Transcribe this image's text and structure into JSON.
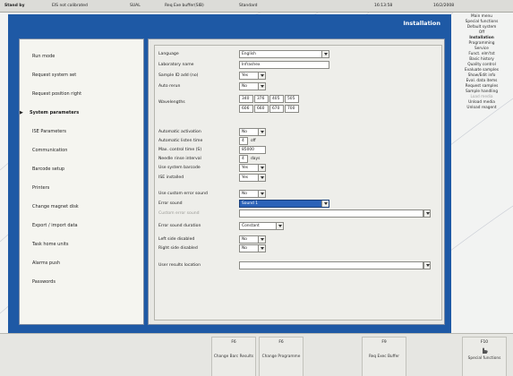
{
  "status_bar": {
    "state": "Stand by",
    "items": [
      "EIS not calibrated",
      "SUAL",
      "Req Exe buffer(SIB)",
      "Standard"
    ],
    "time": "16:13:58",
    "date": "16/2/2008"
  },
  "panel": {
    "title": "Installation"
  },
  "nav": {
    "items": [
      {
        "label": "Run mode",
        "active": false
      },
      {
        "label": "Request system set",
        "active": false
      },
      {
        "label": "Request position right",
        "active": false
      },
      {
        "label": "System parameters",
        "active": true
      },
      {
        "label": "ISE Parameters",
        "active": false
      },
      {
        "label": "Communication",
        "active": false
      },
      {
        "label": "Barcode setup",
        "active": false
      },
      {
        "label": "Printers",
        "active": false
      },
      {
        "label": "Change magnet disk",
        "active": false
      },
      {
        "label": "Export / import data",
        "active": false
      },
      {
        "label": "Task home units",
        "active": false
      },
      {
        "label": "Alarms push",
        "active": false
      },
      {
        "label": "Passwords",
        "active": false
      }
    ]
  },
  "form": {
    "language": {
      "label": "Language",
      "value": "English"
    },
    "lab_name": {
      "label": "Laboratory name",
      "value": "Infrashex"
    },
    "sample_id_bar": {
      "label": "Sample ID add (no)",
      "value": "Yes"
    },
    "auto_rerun": {
      "label": "Auto rerun",
      "value": "No"
    },
    "wavelengths": {
      "label": "Wavelengths",
      "values": [
        "340",
        "376",
        "405",
        "505",
        "606",
        "660",
        "670",
        "700"
      ]
    },
    "automatic_activation": {
      "label": "Automatic activation",
      "value": "No"
    },
    "auto_dilution_time": {
      "label": "Automatic listen time",
      "value": "4",
      "unit": "off"
    },
    "max_control_time": {
      "label": "Max. control time (S)",
      "value": "85000"
    },
    "needle_rinse_interval": {
      "label": "Needle rinse interval",
      "value": "4",
      "unit": "days"
    },
    "use_system_barcode": {
      "label": "Use system barcode",
      "value": "Yes"
    },
    "ise_installed": {
      "label": "ISE installed",
      "value": "Yes"
    },
    "use_custom_error_sound": {
      "label": "Use custom error sound",
      "value": "No"
    },
    "error_sound": {
      "label": "Error sound",
      "value": "Sound 1"
    },
    "custom_error_sound": {
      "label": "Custom error sound",
      "value": ""
    },
    "error_sound_duration": {
      "label": "Error sound duration",
      "value": "Constant"
    },
    "left_side_disabled": {
      "label": "Left side disabled",
      "value": "No"
    },
    "right_side_disabled": {
      "label": "Right side disabled",
      "value": "No"
    },
    "user_results_location": {
      "label": "User results location",
      "value": ""
    }
  },
  "menu_tree": {
    "items": [
      {
        "label": "Main menu",
        "dim": false
      },
      {
        "label": "Special functions",
        "dim": false
      },
      {
        "label": "Default system",
        "dim": false
      },
      {
        "label": "Off",
        "dim": false
      },
      {
        "label": "Installation",
        "dim": false
      },
      {
        "label": "Programming",
        "dim": false
      },
      {
        "label": "Service",
        "dim": false
      },
      {
        "label": "Funct. elm'tst",
        "dim": false
      },
      {
        "label": "Basic history",
        "dim": false
      },
      {
        "label": "Quality control",
        "dim": false
      },
      {
        "label": "Evaluate samples",
        "dim": false
      },
      {
        "label": "Show/Edit info",
        "dim": false
      },
      {
        "label": "Eval. data items",
        "dim": false
      },
      {
        "label": "Request samples",
        "dim": false
      },
      {
        "label": "Sample handling",
        "dim": false
      },
      {
        "label": "Load media",
        "dim": true
      },
      {
        "label": "Unload media",
        "dim": false
      },
      {
        "label": "Unload reagent",
        "dim": false
      }
    ]
  },
  "fkeys": [
    {
      "num": "F6",
      "label": "Change Barc Results"
    },
    {
      "num": "F6",
      "label": "Change Programme"
    },
    {
      "num": "F9",
      "label": "Req Exec Buffer"
    },
    {
      "num": "F10",
      "label": "Special functions"
    }
  ],
  "colors": {
    "panel_blue": "#1e59a5",
    "selection_blue": "#2b62b8",
    "background": "#f2f3f2"
  }
}
